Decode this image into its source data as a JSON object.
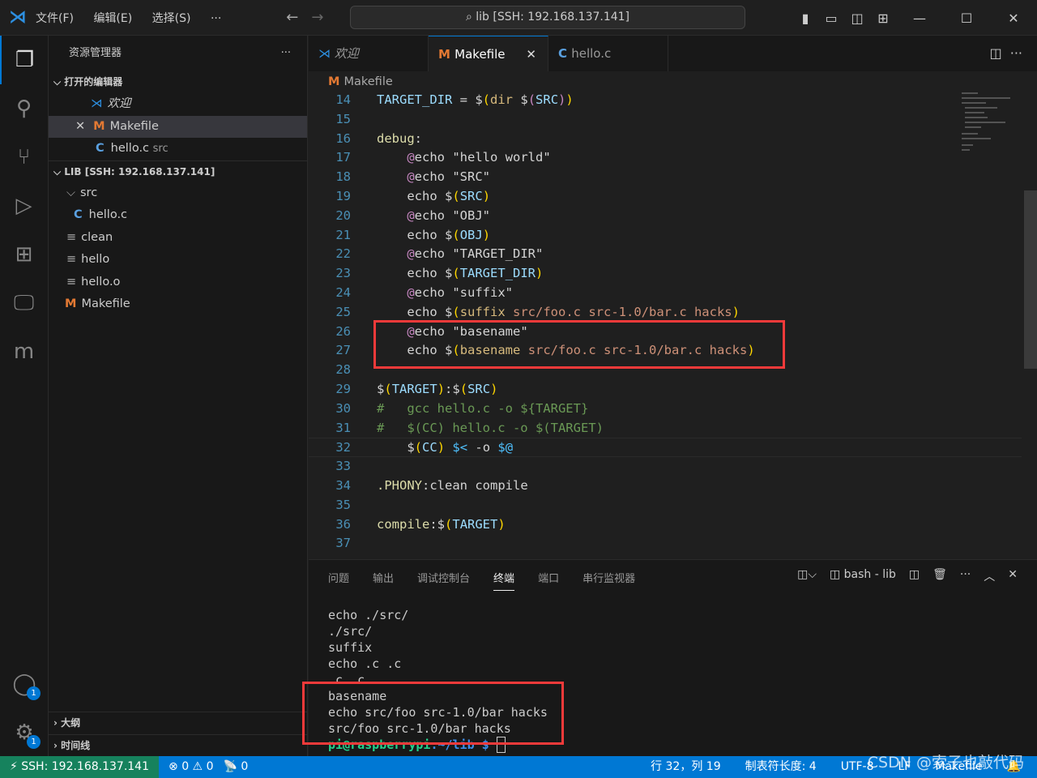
{
  "titlebar": {
    "menus": [
      "文件(F)",
      "编辑(E)",
      "选择(S)",
      "···"
    ],
    "search": "lib [SSH: 192.168.137.141]"
  },
  "sidebar": {
    "title": "资源管理器",
    "more": "···",
    "open_editors": "打开的编辑器",
    "open_items": [
      {
        "icon": "vscode-icon",
        "label": "欢迎"
      },
      {
        "icon": "makefile-icon",
        "label": "Makefile",
        "close": "✕"
      },
      {
        "icon": "c-file-icon",
        "label": "hello.c",
        "desc": "src"
      }
    ],
    "folder": "LIB [SSH: 192.168.137.141]",
    "tree": [
      {
        "label": "src",
        "type": "folder"
      },
      {
        "label": "hello.c",
        "type": "c"
      },
      {
        "label": "clean",
        "type": "file"
      },
      {
        "label": "hello",
        "type": "file"
      },
      {
        "label": "hello.o",
        "type": "file"
      },
      {
        "label": "Makefile",
        "type": "make"
      }
    ],
    "outline": "大纲",
    "timeline": "时间线"
  },
  "tabs": [
    {
      "label": "欢迎",
      "icon": "vscode-icon"
    },
    {
      "label": "Makefile",
      "icon": "makefile-icon",
      "active": true
    },
    {
      "label": "hello.c",
      "icon": "c-file-icon"
    }
  ],
  "breadcrumb": "Makefile",
  "editor": {
    "lines": [
      {
        "n": "14",
        "t": [
          [
            "TARGET_DIR",
            "var"
          ],
          [
            " = ",
            "d"
          ],
          [
            "$",
            "d"
          ],
          [
            "(",
            "p"
          ],
          [
            "dir ",
            "kw"
          ],
          [
            "$",
            "d"
          ],
          [
            "(",
            "at"
          ],
          [
            "SRC",
            "var"
          ],
          [
            ")",
            "at"
          ],
          [
            ")",
            "p"
          ]
        ]
      },
      {
        "n": "15",
        "t": []
      },
      {
        "n": "16",
        "t": [
          [
            "debug",
            "tgt"
          ],
          [
            ":",
            "d"
          ]
        ]
      },
      {
        "n": "17",
        "t": [
          [
            "    ",
            "d"
          ],
          [
            "@",
            "at"
          ],
          [
            "echo ",
            "d"
          ],
          [
            "\"hello world\"",
            "d"
          ]
        ]
      },
      {
        "n": "18",
        "t": [
          [
            "    ",
            "d"
          ],
          [
            "@",
            "at"
          ],
          [
            "echo ",
            "d"
          ],
          [
            "\"SRC\"",
            "d"
          ]
        ]
      },
      {
        "n": "19",
        "t": [
          [
            "    echo ",
            "d"
          ],
          [
            "$",
            "d"
          ],
          [
            "(",
            "p"
          ],
          [
            "SRC",
            "var"
          ],
          [
            ")",
            "p"
          ]
        ]
      },
      {
        "n": "20",
        "t": [
          [
            "    ",
            "d"
          ],
          [
            "@",
            "at"
          ],
          [
            "echo ",
            "d"
          ],
          [
            "\"OBJ\"",
            "d"
          ]
        ]
      },
      {
        "n": "21",
        "t": [
          [
            "    echo ",
            "d"
          ],
          [
            "$",
            "d"
          ],
          [
            "(",
            "p"
          ],
          [
            "OBJ",
            "var"
          ],
          [
            ")",
            "p"
          ]
        ]
      },
      {
        "n": "22",
        "t": [
          [
            "    ",
            "d"
          ],
          [
            "@",
            "at"
          ],
          [
            "echo ",
            "d"
          ],
          [
            "\"TARGET_DIR\"",
            "d"
          ]
        ]
      },
      {
        "n": "23",
        "t": [
          [
            "    echo ",
            "d"
          ],
          [
            "$",
            "d"
          ],
          [
            "(",
            "p"
          ],
          [
            "TARGET_DIR",
            "var"
          ],
          [
            ")",
            "p"
          ]
        ]
      },
      {
        "n": "24",
        "t": [
          [
            "    ",
            "d"
          ],
          [
            "@",
            "at"
          ],
          [
            "echo ",
            "d"
          ],
          [
            "\"suffix\"",
            "d"
          ]
        ]
      },
      {
        "n": "25",
        "t": [
          [
            "    echo ",
            "d"
          ],
          [
            "$",
            "d"
          ],
          [
            "(",
            "p"
          ],
          [
            "suffix ",
            "kw"
          ],
          [
            "src/foo.c src-1.0/bar.c hacks",
            "arg"
          ],
          [
            ")",
            "p"
          ]
        ]
      },
      {
        "n": "26",
        "t": [
          [
            "    ",
            "d"
          ],
          [
            "@",
            "at"
          ],
          [
            "echo ",
            "d"
          ],
          [
            "\"basename\"",
            "d"
          ]
        ]
      },
      {
        "n": "27",
        "t": [
          [
            "    echo ",
            "d"
          ],
          [
            "$",
            "d"
          ],
          [
            "(",
            "p"
          ],
          [
            "basename ",
            "kw"
          ],
          [
            "src/foo.c src-1.0/bar.c hacks",
            "arg"
          ],
          [
            ")",
            "p"
          ]
        ]
      },
      {
        "n": "28",
        "t": []
      },
      {
        "n": "29",
        "t": [
          [
            "$",
            "d"
          ],
          [
            "(",
            "p"
          ],
          [
            "TARGET",
            "var"
          ],
          [
            ")",
            "p"
          ],
          [
            ":",
            "d"
          ],
          [
            "$",
            "d"
          ],
          [
            "(",
            "p"
          ],
          [
            "SRC",
            "var"
          ],
          [
            ")",
            "p"
          ]
        ]
      },
      {
        "n": "30",
        "t": [
          [
            "#   gcc hello.c -o ${TARGET}",
            "cm"
          ]
        ]
      },
      {
        "n": "31",
        "t": [
          [
            "#   $(CC) hello.c -o $(TARGET)",
            "cm"
          ]
        ]
      },
      {
        "n": "32",
        "t": [
          [
            "    ",
            "d"
          ],
          [
            "$",
            "d"
          ],
          [
            "(",
            "p"
          ],
          [
            "CC",
            "var"
          ],
          [
            ")",
            "p"
          ],
          [
            " ",
            "d"
          ],
          [
            "$<",
            "sp"
          ],
          [
            " -o ",
            "d"
          ],
          [
            "$@",
            "sp"
          ]
        ],
        "current": true
      },
      {
        "n": "33",
        "t": []
      },
      {
        "n": "34",
        "t": [
          [
            ".PHONY",
            "tgt"
          ],
          [
            ":clean compile",
            "d"
          ]
        ]
      },
      {
        "n": "35",
        "t": []
      },
      {
        "n": "36",
        "t": [
          [
            "compile",
            "tgt"
          ],
          [
            ":",
            "d"
          ],
          [
            "$",
            "d"
          ],
          [
            "(",
            "p"
          ],
          [
            "TARGET",
            "var"
          ],
          [
            ")",
            "p"
          ]
        ]
      },
      {
        "n": "37",
        "t": []
      }
    ]
  },
  "panel": {
    "tabs": [
      "问题",
      "输出",
      "调试控制台",
      "终端",
      "端口",
      "串行监视器"
    ],
    "active_tab": "终端",
    "terminal_name": "bash - lib",
    "output": [
      "echo ./src/",
      "./src/",
      "suffix",
      "echo .c .c",
      ".c .c",
      "basename",
      "echo src/foo src-1.0/bar hacks",
      "src/foo src-1.0/bar hacks"
    ],
    "prompt_user": "pi@raspberrypi",
    "prompt_path": ":~/lib $"
  },
  "status": {
    "remote": "SSH: 192.168.137.141",
    "errors": "0",
    "warnings": "0",
    "ports": "0",
    "position": "行 32，列 19",
    "tab_size": "制表符长度: 4",
    "encoding": "UTF-8",
    "eol": "LF",
    "language": "Makefile"
  },
  "watermark": "CSDN @索子也敲代码",
  "colors": {
    "accent": "#0078d4",
    "remote": "#16825d",
    "highlight_box": "#f23a3a"
  }
}
